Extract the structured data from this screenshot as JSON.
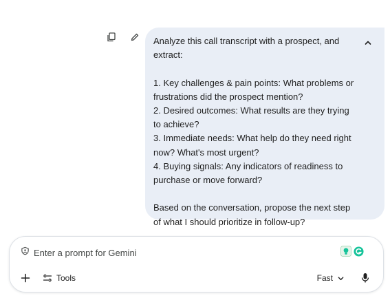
{
  "message": {
    "text": "Analyze this call transcript with a prospect, and extract:\n\n1. Key challenges & pain points: What problems or frustrations did the prospect mention?\n2. Desired outcomes: What results are they trying to achieve?\n3. Immediate needs: What help do they need right now? What's most urgent?\n4. Buying signals: Any indicators of readiness to purchase or move forward?\n\nBased on the conversation, propose the next step of what I should prioritize in follow-up?",
    "actions": [
      "copy-icon",
      "edit-icon"
    ],
    "collapse_icon": "chevron-up-icon"
  },
  "composer": {
    "placeholder": "Enter a prompt for Gemini",
    "privacy_icon": "shield-icon",
    "extension_icons": [
      "lightbulb-icon",
      "grammarly-icon"
    ],
    "add_icon": "plus-icon",
    "tools_label": "Tools",
    "model_label": "Fast",
    "mic_icon": "microphone-icon"
  },
  "colors": {
    "bubble_bg": "#e9eef6",
    "text": "#1f1f1f",
    "grammarly": "#15c39a"
  }
}
